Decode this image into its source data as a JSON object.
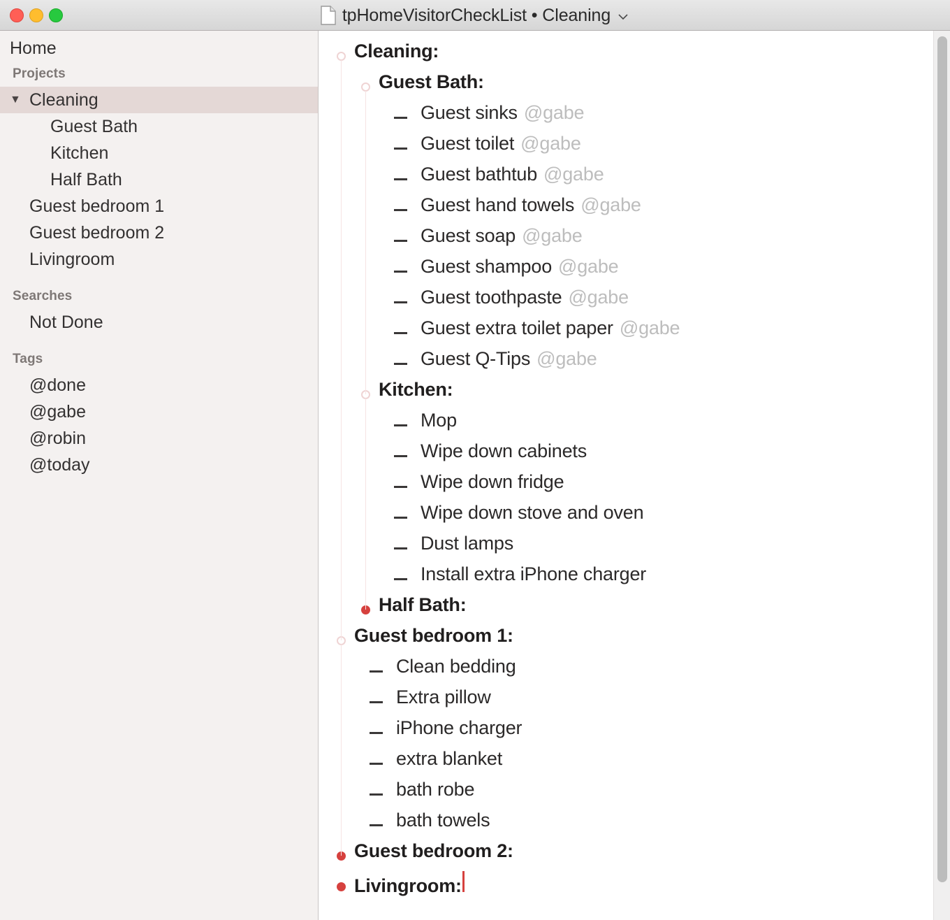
{
  "window": {
    "title": "tpHomeVisitorCheckList • Cleaning",
    "doc_icon": "document-icon",
    "chevron_icon": "chevron-down-icon",
    "traffic_lights": [
      "close-button",
      "minimize-button",
      "zoom-button"
    ],
    "colors": {
      "accent_red": "#d6413e",
      "bullet_hollow": "#efd4d4",
      "tag_gray": "#bdbdbd",
      "sidebar_bg": "#f4f1f0",
      "selected_bg": "#e4d8d6",
      "guide_line": "#f6e4e4"
    }
  },
  "sidebar": {
    "home_label": "Home",
    "sections": [
      {
        "header": "Projects",
        "items": [
          {
            "label": "Cleaning",
            "selected": true,
            "disclosure": "▼",
            "indent": 0
          },
          {
            "label": "Guest Bath",
            "selected": false,
            "indent": 1
          },
          {
            "label": "Kitchen",
            "selected": false,
            "indent": 1
          },
          {
            "label": "Half Bath",
            "selected": false,
            "indent": 1
          },
          {
            "label": "Guest bedroom 1",
            "selected": false,
            "indent": 0
          },
          {
            "label": "Guest bedroom 2",
            "selected": false,
            "indent": 0
          },
          {
            "label": "Livingroom",
            "selected": false,
            "indent": 0
          }
        ]
      },
      {
        "header": "Searches",
        "items": [
          {
            "label": "Not Done",
            "selected": false,
            "indent": 0
          }
        ]
      },
      {
        "header": "Tags",
        "items": [
          {
            "label": "@done",
            "selected": false,
            "indent": 0
          },
          {
            "label": "@gabe",
            "selected": false,
            "indent": 0
          },
          {
            "label": "@robin",
            "selected": false,
            "indent": 0
          },
          {
            "label": "@today",
            "selected": false,
            "indent": 0
          }
        ]
      }
    ]
  },
  "outline": {
    "rows": [
      {
        "type": "project",
        "level": 0,
        "bullet": "hollow",
        "text": "Cleaning:"
      },
      {
        "type": "project",
        "level": 1,
        "bullet": "hollow",
        "text": "Guest Bath:"
      },
      {
        "type": "task",
        "level": 2,
        "text": "Guest sinks",
        "tag": "@gabe"
      },
      {
        "type": "task",
        "level": 2,
        "text": "Guest toilet",
        "tag": "@gabe"
      },
      {
        "type": "task",
        "level": 2,
        "text": "Guest bathtub",
        "tag": "@gabe"
      },
      {
        "type": "task",
        "level": 2,
        "text": "Guest hand towels",
        "tag": "@gabe"
      },
      {
        "type": "task",
        "level": 2,
        "text": "Guest soap",
        "tag": "@gabe"
      },
      {
        "type": "task",
        "level": 2,
        "text": "Guest shampoo",
        "tag": "@gabe"
      },
      {
        "type": "task",
        "level": 2,
        "text": "Guest toothpaste",
        "tag": "@gabe"
      },
      {
        "type": "task",
        "level": 2,
        "text": "Guest extra toilet paper",
        "tag": "@gabe"
      },
      {
        "type": "task",
        "level": 2,
        "text": "Guest Q-Tips",
        "tag": "@gabe"
      },
      {
        "type": "project",
        "level": 1,
        "bullet": "hollow",
        "text": "Kitchen:"
      },
      {
        "type": "task",
        "level": 2,
        "text": "Mop",
        "tag": ""
      },
      {
        "type": "task",
        "level": 2,
        "text": "Wipe down cabinets",
        "tag": ""
      },
      {
        "type": "task",
        "level": 2,
        "text": "Wipe down fridge",
        "tag": ""
      },
      {
        "type": "task",
        "level": 2,
        "text": "Wipe down stove and oven",
        "tag": ""
      },
      {
        "type": "task",
        "level": 2,
        "text": "Dust lamps",
        "tag": ""
      },
      {
        "type": "task",
        "level": 2,
        "text": "Install extra iPhone charger",
        "tag": ""
      },
      {
        "type": "project",
        "level": 1,
        "bullet": "filled",
        "text": "Half Bath:"
      },
      {
        "type": "project",
        "level": 0,
        "bullet": "hollow",
        "text": "Guest bedroom 1:"
      },
      {
        "type": "task",
        "level": 1,
        "text": "Clean bedding",
        "tag": ""
      },
      {
        "type": "task",
        "level": 1,
        "text": "Extra pillow",
        "tag": ""
      },
      {
        "type": "task",
        "level": 1,
        "text": "iPhone charger",
        "tag": ""
      },
      {
        "type": "task",
        "level": 1,
        "text": "extra blanket",
        "tag": ""
      },
      {
        "type": "task",
        "level": 1,
        "text": "bath robe",
        "tag": ""
      },
      {
        "type": "task",
        "level": 1,
        "text": "bath towels",
        "tag": ""
      },
      {
        "type": "project",
        "level": 0,
        "bullet": "filled",
        "text": "Guest bedroom 2:"
      },
      {
        "type": "project",
        "level": 0,
        "bullet": "filled",
        "text": "Livingroom:",
        "caret": true
      }
    ]
  },
  "scrollbar": {
    "name": "vertical-scrollbar",
    "thumb_top_pct": 0,
    "thumb_height_pct": 95
  }
}
